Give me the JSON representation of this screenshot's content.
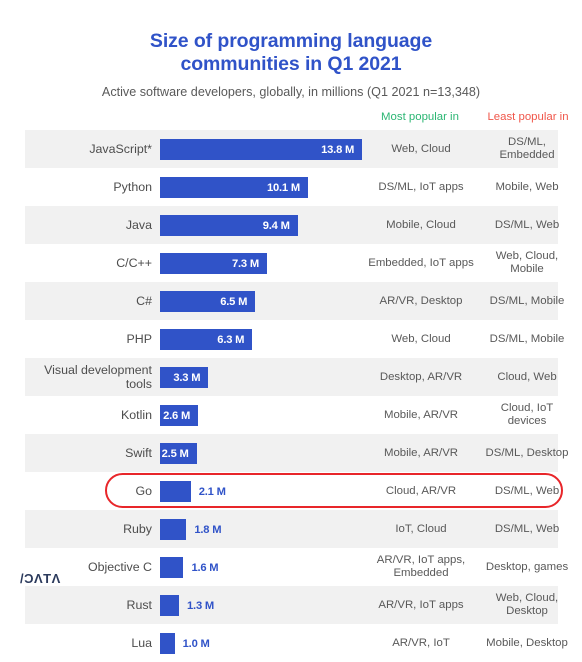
{
  "header": {
    "title_line1": "Size of programming language",
    "title_line2": "communities in Q1 2021",
    "subtitle": "Active software developers, globally, in millions (Q1 2021 n=13,348)",
    "title_color": "#3053c8"
  },
  "columns": {
    "most_popular": "Most popular in",
    "least_popular": "Least popular in",
    "most_color": "#2bb673",
    "least_color": "#f0564a"
  },
  "logo": {
    "text": "/ƆΛTΛ"
  },
  "highlight": {
    "row_language": "Go",
    "color": "#e8262a"
  },
  "chart_data": {
    "type": "bar",
    "title": "Size of programming language communities in Q1 2021",
    "subtitle": "Active software developers, globally, in millions (Q1 2021 n=13,348)",
    "xlabel": "Active software developers (millions)",
    "ylabel": "",
    "orientation": "horizontal",
    "xlim": [
      0,
      14.5
    ],
    "grid": false,
    "legend": "none",
    "bar_color": "#3053c8",
    "unit_suffix": "M",
    "categories": [
      "JavaScript*",
      "Python",
      "Java",
      "C/C++",
      "C#",
      "PHP",
      "Visual development\ntools",
      "Kotlin",
      "Swift",
      "Go",
      "Ruby",
      "Objective C",
      "Rust",
      "Lua"
    ],
    "values": [
      13.8,
      10.1,
      9.4,
      7.3,
      6.5,
      6.3,
      3.3,
      2.6,
      2.5,
      2.1,
      1.8,
      1.6,
      1.3,
      1.0
    ],
    "value_labels": [
      "13.8 M",
      "10.1 M",
      "9.4 M",
      "7.3 M",
      "6.5 M",
      "6.3 M",
      "3.3 M",
      "2.6 M",
      "2.5 M",
      "2.1 M",
      "1.8 M",
      "1.6 M",
      "1.3 M",
      "1.0 M"
    ],
    "most_popular_in": [
      "Web, Cloud",
      "DS/ML, IoT apps",
      "Mobile, Cloud",
      "Embedded, IoT apps",
      "AR/VR, Desktop",
      "Web, Cloud",
      "Desktop, AR/VR",
      "Mobile, AR/VR",
      "Mobile, AR/VR",
      "Cloud, AR/VR",
      "IoT, Cloud",
      "AR/VR, IoT apps,\nEmbedded",
      "AR/VR, IoT apps",
      "AR/VR, IoT"
    ],
    "least_popular_in": [
      "DS/ML,\nEmbedded",
      "Mobile, Web",
      "DS/ML, Web",
      "Web, Cloud,\nMobile",
      "DS/ML, Mobile",
      "DS/ML, Mobile",
      "Cloud, Web",
      "Cloud, IoT\ndevices",
      "DS/ML, Desktop",
      "DS/ML, Web",
      "DS/ML, Web",
      "Desktop, games",
      "Web, Cloud,\nDesktop",
      "Mobile, Desktop"
    ]
  }
}
